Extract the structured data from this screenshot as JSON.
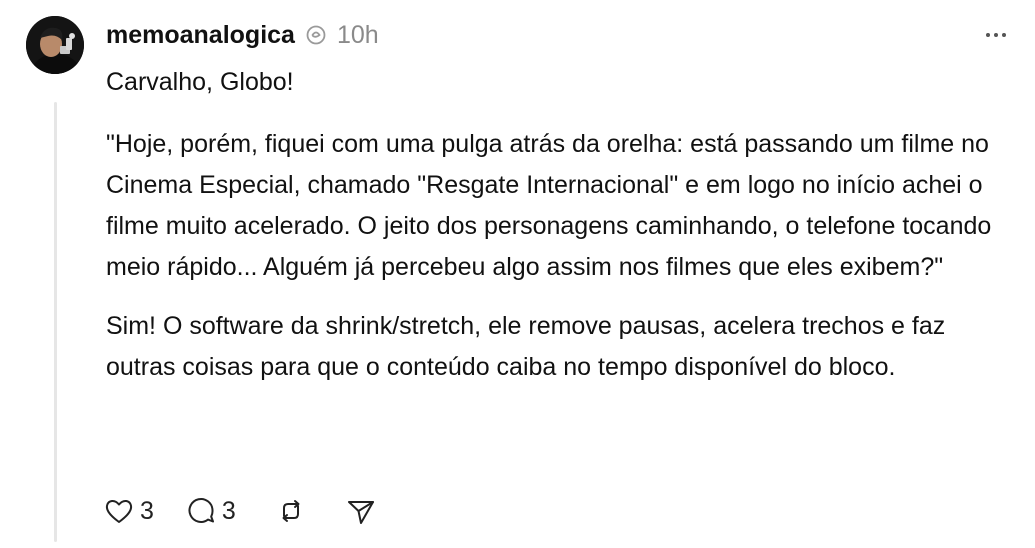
{
  "post": {
    "username": "memoanalogica",
    "verified_icon": "threads-verified-icon",
    "time": "10h",
    "paragraphs": [
      "Carvalho, Globo!",
      "\"Hoje, porém, fiquei com uma pulga atrás da orelha: está passando um filme no Cinema Especial, chamado \"Resgate Internacional\" e em logo no início achei o filme muito acelerado. O jeito dos personagens caminhando, o telefone tocando meio rápido... Alguém já percebeu algo assim nos filmes que eles exibem?\"",
      "Sim! O software da shrink/stretch, ele remove pausas, acelera trechos e faz outras coisas para que o conteúdo caiba no tempo disponível do bloco."
    ]
  },
  "actions": {
    "likes": "3",
    "replies": "3"
  },
  "icons": {
    "like": "heart-icon",
    "reply": "comment-icon",
    "repost": "repost-icon",
    "share": "send-icon",
    "more": "more-options-icon"
  }
}
